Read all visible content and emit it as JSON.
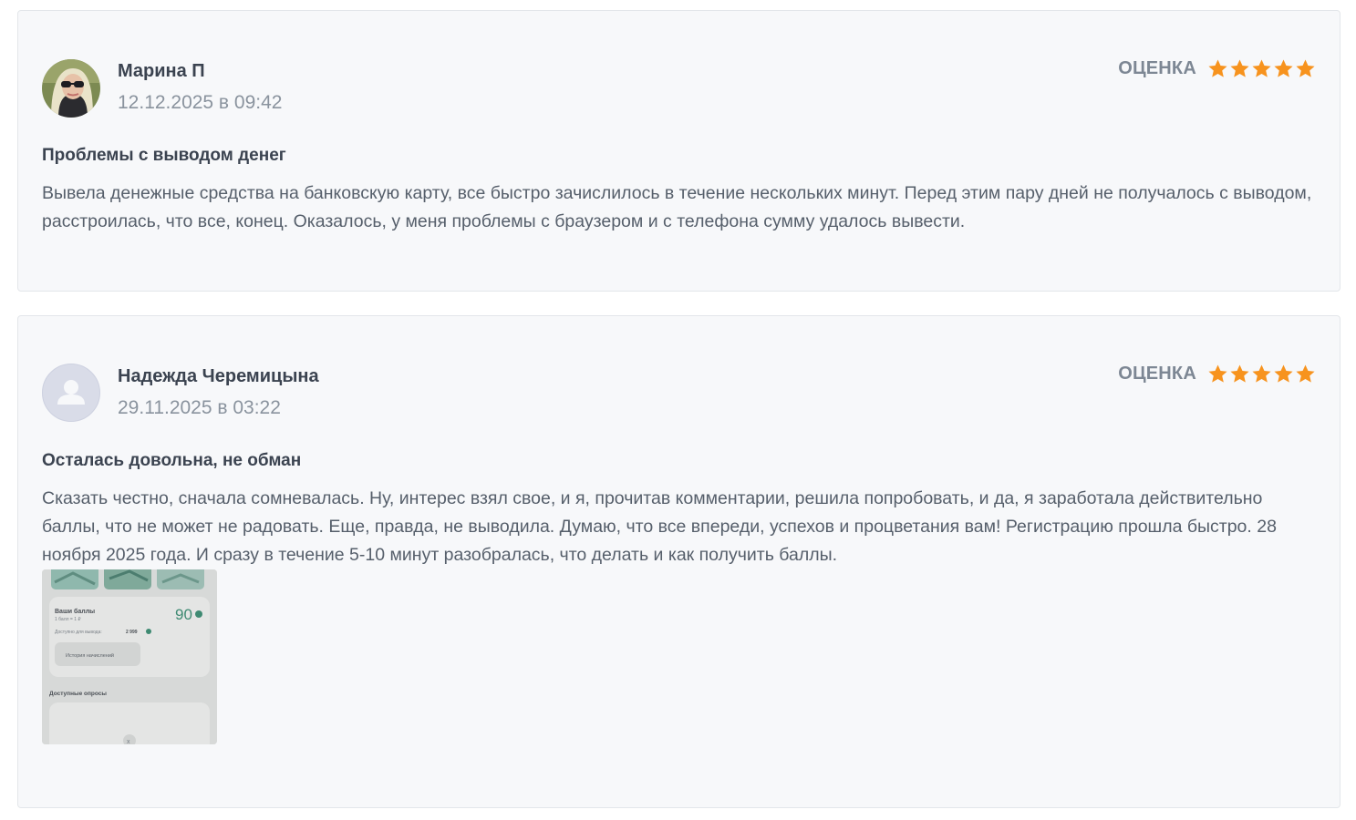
{
  "reviews": [
    {
      "author": "Марина П",
      "date": "12.12.2025 в 09:42",
      "rating_label": "ОЦЕНКА",
      "rating": 5,
      "title": "Проблемы с выводом денег",
      "text": "Вывела денежные средства на банковскую карту, все быстро зачислилось в течение нескольких минут. Перед этим пару дней не получалось с выводом, расстроилась, что все, конец. Оказалось, у меня проблемы с браузером и с телефона сумму удалось вывести."
    },
    {
      "author": "Надежда Черемицына",
      "date": "29.11.2025 в 03:22",
      "rating_label": "ОЦЕНКА",
      "rating": 5,
      "title": "Осталась довольна, не обман",
      "text": "Сказать честно, сначала сомневалась. Ну, интерес взял свое, и я, прочитав комментарии, решила попробовать, и да, я заработала действительно баллы, что не может не радовать. Еще, правда, не выводила. Думаю, что все впереди, успехов и процветания вам! Регистрацию прошла быстро. 28 ноября 2025 года. И сразу в течение 5-10 минут разобралась, что делать и как получить баллы.",
      "attachment": {
        "balance_label": "Ваши баллы",
        "rate_label": "1 балл = 1 ₽",
        "balance_value": "90",
        "available_label": "Доступно для вывода:",
        "available_value": "2 999",
        "history_button": "История начислений",
        "surveys_heading": "Доступные опросы"
      }
    }
  ],
  "colors": {
    "star": "#f7931e",
    "card_bg": "#f7f8fa",
    "name": "#3b4350",
    "muted": "#8a939e"
  }
}
